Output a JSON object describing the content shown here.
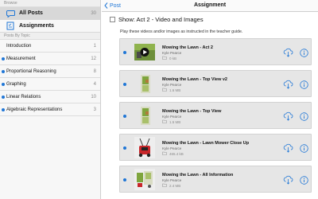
{
  "sidebar": {
    "browse_header": "Browse",
    "all_posts": {
      "label": "All Posts",
      "count": "30"
    },
    "assignments": {
      "label": "Assignments",
      "count": ""
    },
    "topics_header": "Posts By Topic",
    "topics": [
      {
        "label": "Introduction",
        "count": "1",
        "dot": false
      },
      {
        "label": "Measurement",
        "count": "12",
        "dot": true
      },
      {
        "label": "Proportional Reasoning",
        "count": "8",
        "dot": true
      },
      {
        "label": "Graphing",
        "count": "4",
        "dot": true
      },
      {
        "label": "Linear Relations",
        "count": "10",
        "dot": true
      },
      {
        "label": "Algebraic Representations",
        "count": "3",
        "dot": true
      }
    ]
  },
  "navbar": {
    "back_label": "Post",
    "title": "Assignment"
  },
  "content": {
    "show_title": "Show: Act 2 - Video and Images",
    "instructions": "Play these videos and/or images as instructed in the teacher guide."
  },
  "cards": [
    {
      "title": "Mowing the Lawn - Act 2",
      "author": "Kyle Pearce",
      "size": "0 kB",
      "thumb": "video-thumbnail"
    },
    {
      "title": "Mowing the Lawn - Top View v2",
      "author": "Kyle Pearce",
      "size": "1.6 MB",
      "thumb": "lawn-image"
    },
    {
      "title": "Mowing the Lawn - Top View",
      "author": "Kyle Pearce",
      "size": "1.5 MB",
      "thumb": "lawn-image"
    },
    {
      "title": "Mowing the Lawn - Lawn Mower Close Up",
      "author": "Kyle Pearce",
      "size": "465.4 kB",
      "thumb": "mower-image"
    },
    {
      "title": "Mowing the Lawn - All Information",
      "author": "Kyle Pearce",
      "size": "2.4 MB",
      "thumb": "lawn-info-image"
    }
  ],
  "colors": {
    "accent": "#1f76d6",
    "card_bg": "#e6e6e6",
    "sidebar_bg": "#f7f7f7",
    "selected_bg": "#d8d8d8"
  },
  "icons": [
    "chat-bubble-icon",
    "checklist-icon",
    "back-chevron-icon",
    "cloud-download-icon",
    "info-icon",
    "folder-icon",
    "play-icon"
  ]
}
